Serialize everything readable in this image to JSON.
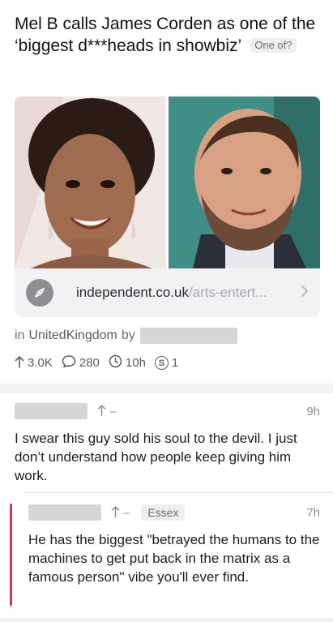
{
  "post": {
    "title": "Mel B calls James Corden as one of the ‘biggest d***heads in showbiz’",
    "flair": "One of?",
    "link_domain": "independent.co.uk",
    "link_path": "/arts-entert...",
    "subreddit_prefix": "in",
    "subreddit": "UnitedKingdom",
    "by_label": "by",
    "upvotes": "3.0K",
    "comments": "280",
    "age": "10h",
    "awards": "1",
    "award_icon_text": "S"
  },
  "comments": [
    {
      "score": "–",
      "time": "9h",
      "body": "I swear this guy sold his soul to the devil. I just don’t understand how people keep giving him work."
    },
    {
      "score": "–",
      "flair": "Essex",
      "time": "7h",
      "body": "He has the biggest \"betrayed the humans to the machines to get put back in the matrix as a famous person\" vibe you'll ever find."
    }
  ],
  "icons": {
    "link": "compass-icon",
    "chevron": "chevron-right-icon",
    "upvote": "arrow-up-icon",
    "comments": "speech-bubble-icon",
    "age": "clock-icon",
    "award": "award-icon"
  },
  "colors": {
    "accent_reply_line": "#e0334b",
    "redaction": "#d6d6d8"
  }
}
